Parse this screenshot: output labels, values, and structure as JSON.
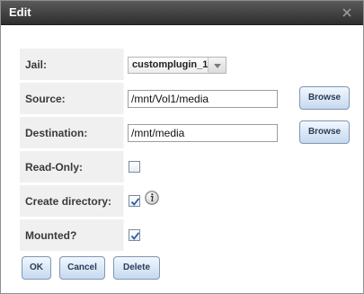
{
  "dialog": {
    "title": "Edit",
    "close_icon": "close-x-icon"
  },
  "form": {
    "jail": {
      "label": "Jail:",
      "selected": "customplugin_1"
    },
    "source": {
      "label": "Source:",
      "value": "/mnt/Vol1/media",
      "browse_label": "Browse"
    },
    "destination": {
      "label": "Destination:",
      "value": "/mnt/media",
      "browse_label": "Browse"
    },
    "read_only": {
      "label": "Read-Only:",
      "checked": false
    },
    "create_directory": {
      "label": "Create directory:",
      "checked": true,
      "info_icon": "info-icon"
    },
    "mounted": {
      "label": "Mounted?",
      "checked": true
    }
  },
  "actions": {
    "ok_label": "OK",
    "cancel_label": "Cancel",
    "delete_label": "Delete"
  },
  "colors": {
    "titlebar": "#3d3d3d",
    "label_bg": "#f0f0f0",
    "button_bg": "#c6d9f0",
    "check_color": "#2b5fa8"
  }
}
